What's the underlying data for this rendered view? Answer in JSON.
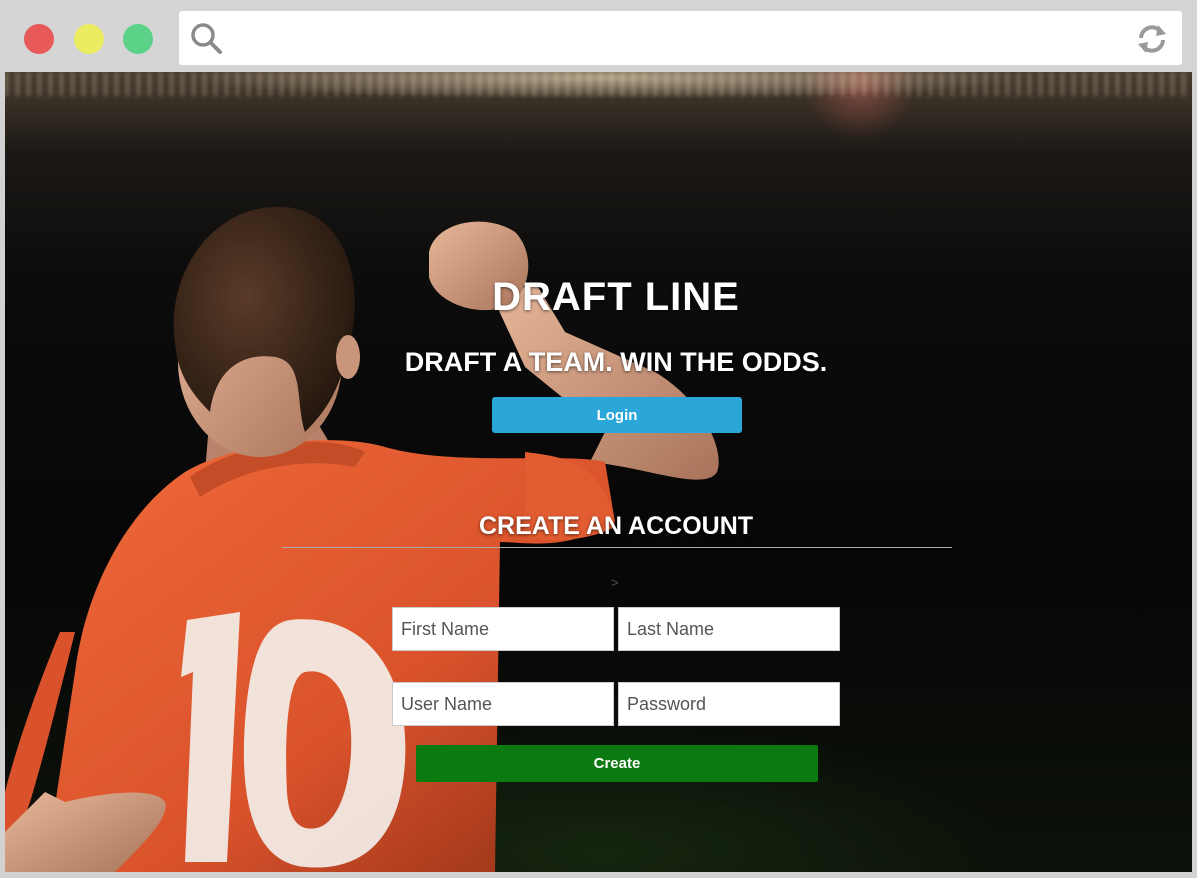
{
  "browser": {
    "address_value": "",
    "icons": {
      "search": "search-icon",
      "reload": "reload-icon"
    },
    "traffic_lights": [
      "#e85a5a",
      "#ecec63",
      "#5cd188"
    ]
  },
  "hero": {
    "title": "DRAFT LINE",
    "tagline": "DRAFT A TEAM. WIN THE ODDS.",
    "login_label": "Login",
    "jersey_number": "10"
  },
  "signup": {
    "heading": "CREATE AN ACCOUNT",
    "stray_glyph": ">",
    "first_name_placeholder": "First Name",
    "last_name_placeholder": "Last Name",
    "username_placeholder": "User Name",
    "password_placeholder": "Password",
    "create_label": "Create"
  },
  "colors": {
    "login_button": "#2aa7d8",
    "create_button": "#0b7a10",
    "jersey": "#e4582f"
  }
}
